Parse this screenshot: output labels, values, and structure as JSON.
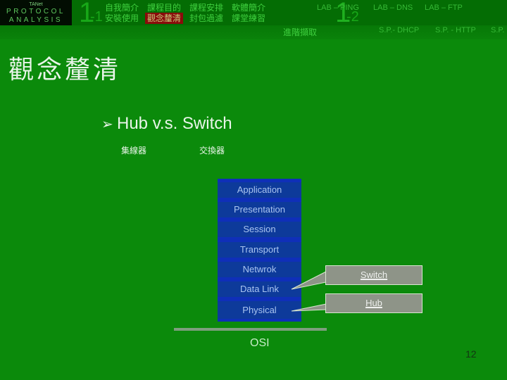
{
  "header": {
    "logo": {
      "small": "TANet",
      "line1": "PROTOCOL",
      "line2": "ANALYSIS"
    },
    "section1": {
      "big": "1",
      "sub": "-1"
    },
    "section2": {
      "big": "1",
      "sub": "-2"
    },
    "nav_row1": [
      "自我簡介",
      "課程目的",
      "課程安排",
      "軟體簡介"
    ],
    "nav_row2": [
      "安裝使用",
      "觀念釐清",
      "封包過濾",
      "課堂練習"
    ],
    "active_nav": "觀念釐清",
    "labs_row1": [
      "LAB – PING",
      "LAB – DNS",
      "LAB – FTP"
    ],
    "advanced": "進階擷取",
    "labs_row2": [
      "S.P.- DHCP",
      "S.P. - HTTP",
      "S.P."
    ]
  },
  "main": {
    "title": "觀念釐清",
    "bullet": "Hub v.s. Switch",
    "hub_cn": "集線器",
    "switch_cn": "交換器"
  },
  "osi": {
    "layers": [
      "Application",
      "Presentation",
      "Session",
      "Transport",
      "Netwrok",
      "Data Link",
      "Physical"
    ],
    "label": "OSI"
  },
  "callouts": {
    "switch": "Switch",
    "hub": "Hub"
  },
  "page_number": "12",
  "colors": {
    "background": "#0b8a0b",
    "active_nav_bg": "#8a0b0b",
    "osi_layer": "#0d3a9a",
    "callout_bg": "#8e9488"
  }
}
